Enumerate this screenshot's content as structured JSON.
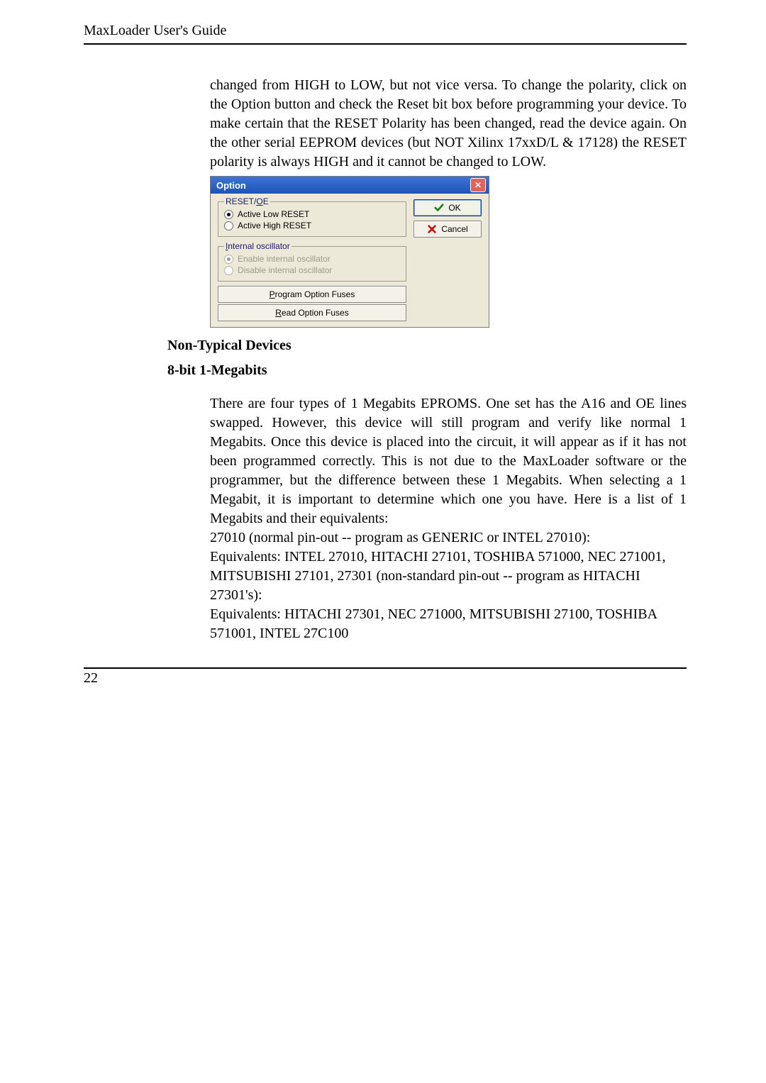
{
  "header": {
    "running": "MaxLoader User's Guide"
  },
  "intro_para": "changed from HIGH to LOW, but not vice versa.  To change the polarity, click on the Option button and check the Reset bit box before programming your device.  To make certain that the RESET Polarity has been changed, read the device again. On the other serial EEPROM devices (but NOT Xilinx 17xxD/L & 17128) the RESET polarity is always HIGH and it cannot be changed to LOW.",
  "dialog": {
    "title": "Option",
    "close": "✕",
    "group1": {
      "legend": "RESET/OE",
      "opt1": "Active Low RESET",
      "opt2": "Active High RESET"
    },
    "group2": {
      "legend": "Internal oscillator",
      "opt1": "Enable internal oscillator",
      "opt2": "Disable internal oscillator"
    },
    "btn_prog": "Program Option Fuses",
    "btn_read": "Read Option Fuses",
    "btn_ok": "OK",
    "btn_cancel": "Cancel"
  },
  "h_nontypical": "Non-Typical Devices",
  "h_8bit": "8-bit 1-Megabits",
  "body_para": "There are four types of 1 Megabits EPROMS. One set has the A16 and OE lines swapped.  However, this device will still program and verify like normal 1 Megabits.  Once this device is placed into the circuit, it will appear as if it has not been programmed correctly. This is not due to the MaxLoader software or the programmer, but the difference between these 1 Megabits. When selecting a 1 Megabit, it is important to determine which one you have. Here is a list of 1 Megabits and their equivalents:",
  "line1": "27010 (normal pin-out -- program as GENERIC or INTEL 27010):",
  "line2": "Equivalents: INTEL 27010, HITACHI 27101, TOSHIBA 571000, NEC 271001, MITSUBISHI 27101, 27301 (non-standard pin-out -- program as HITACHI 27301's):",
  "line3": "Equivalents: HITACHI 27301, NEC 271000, MITSUBISHI 27100, TOSHIBA 571001, INTEL 27C100",
  "page_number": "22"
}
